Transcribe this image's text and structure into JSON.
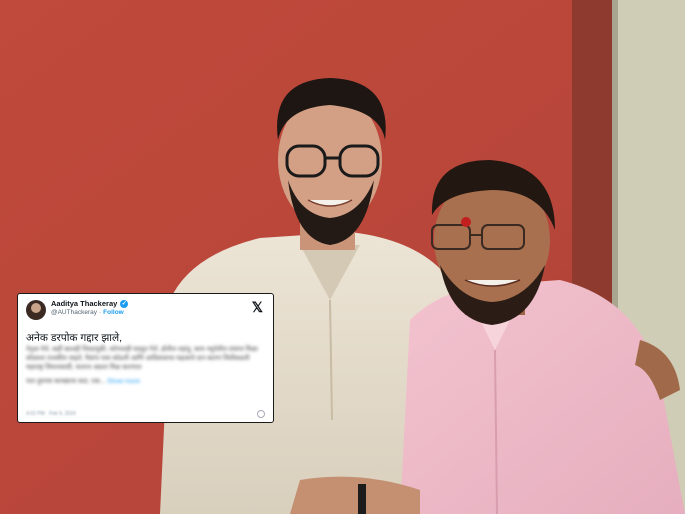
{
  "tweet": {
    "author_name": "Aaditya Thackeray",
    "author_handle": "@AUThackeray",
    "separator": "·",
    "follow_label": "Follow",
    "verified_glyph": "✓",
    "x_logo": "𝕏",
    "first_line": "अनेक डरपोक गद्दार झाले, ",
    "blurred_paragraph": "नेतृत्व गेले, कहीं कालही निवडणूकी, कोणताही घडवून गेले, होतील तहांतु, काय नमुनेतील ग्रंथांना मिळा सोडवला राजकीय चाहते, पैसांच पास कोठली आणि आदिवासाचा महत्वाचे दान कारण जितीकडली महाराष्ट्र जिवनासाठी, यालाच अप्रतर मिळ कारणात",
    "blurred_line_two": "पात तुमच्या कायद्याचा सदा, एक...",
    "show_more_label": "Show more",
    "meta": "4:02 PM · Feb 9, 2024"
  },
  "icons": {
    "avatar": "avatar-icon",
    "verified": "verified-badge-icon",
    "x": "x-logo-icon",
    "info": "info-icon"
  },
  "colors": {
    "wall": "#b9483a",
    "tweet_link": "#1d9bf0",
    "card_bg": "#ffffff"
  }
}
